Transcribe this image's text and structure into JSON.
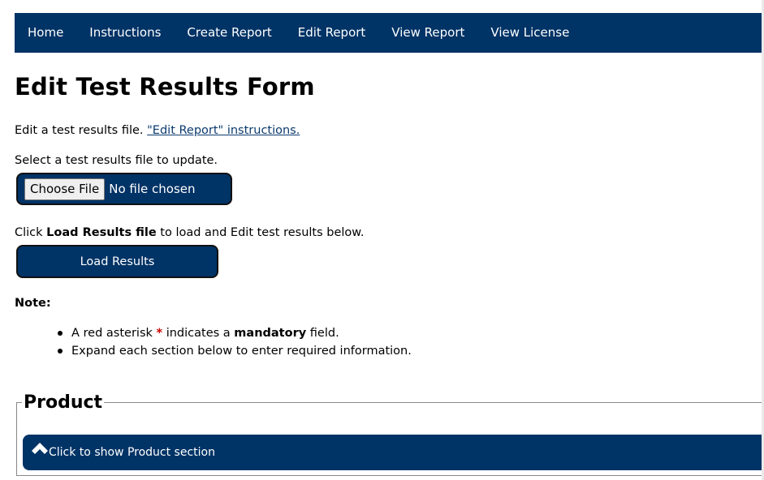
{
  "nav": {
    "items": [
      {
        "label": "Home"
      },
      {
        "label": "Instructions"
      },
      {
        "label": "Create Report"
      },
      {
        "label": "Edit Report"
      },
      {
        "label": "View Report"
      },
      {
        "label": "View License"
      }
    ]
  },
  "page": {
    "title": "Edit Test Results Form",
    "intro_text": "Edit a test results file. ",
    "intro_link": "\"Edit Report\" instructions.",
    "select_prompt": "Select a test results file to update.",
    "file_button": "Choose File",
    "file_status": "No file chosen",
    "load_prompt_prefix": "Click ",
    "load_prompt_bold": "Load Results file",
    "load_prompt_suffix": " to load and Edit test results below.",
    "load_button": "Load Results",
    "note_label": "Note:",
    "note_items": {
      "item1_prefix": "A red asterisk ",
      "item1_asterisk": "*",
      "item1_mid": " indicates a ",
      "item1_bold": "mandatory",
      "item1_suffix": " field.",
      "item2": "Expand each section below to enter required information."
    }
  },
  "product": {
    "legend": "Product",
    "toggle_label": "Click to show Product section",
    "toggle_icon": "chevron-up-icon"
  },
  "colors": {
    "nav_bg": "#003366",
    "button_bg": "#003366",
    "asterisk": "#cc0000",
    "link": "#0b3a6e"
  }
}
